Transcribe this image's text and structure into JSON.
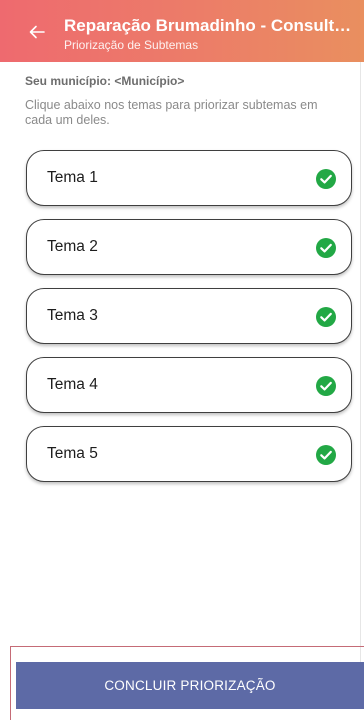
{
  "app_bar": {
    "title": "Reparação Brumadinho - Consulta...",
    "subtitle": "Priorização de Subtemas",
    "back_icon": "arrow-left-icon",
    "gradient_colors": [
      "#ee6a6f",
      "#e98f5f"
    ]
  },
  "municipio": {
    "label": "Seu município:",
    "value": "<Município>"
  },
  "instructions": "Clique abaixo nos temas para priorizar subtemas em cada um deles.",
  "themes": [
    {
      "label": "Tema 1",
      "status_icon": "check-circle-icon",
      "completed": true
    },
    {
      "label": "Tema 2",
      "status_icon": "check-circle-icon",
      "completed": true
    },
    {
      "label": "Tema 3",
      "status_icon": "check-circle-icon",
      "completed": true
    },
    {
      "label": "Tema 4",
      "status_icon": "check-circle-icon",
      "completed": true
    },
    {
      "label": "Tema 5",
      "status_icon": "check-circle-icon",
      "completed": true
    }
  ],
  "check_color": "#22a845",
  "footer": {
    "button_label": "CONCLUIR PRIORIZAÇÃO",
    "button_color": "#5d6aa6"
  }
}
